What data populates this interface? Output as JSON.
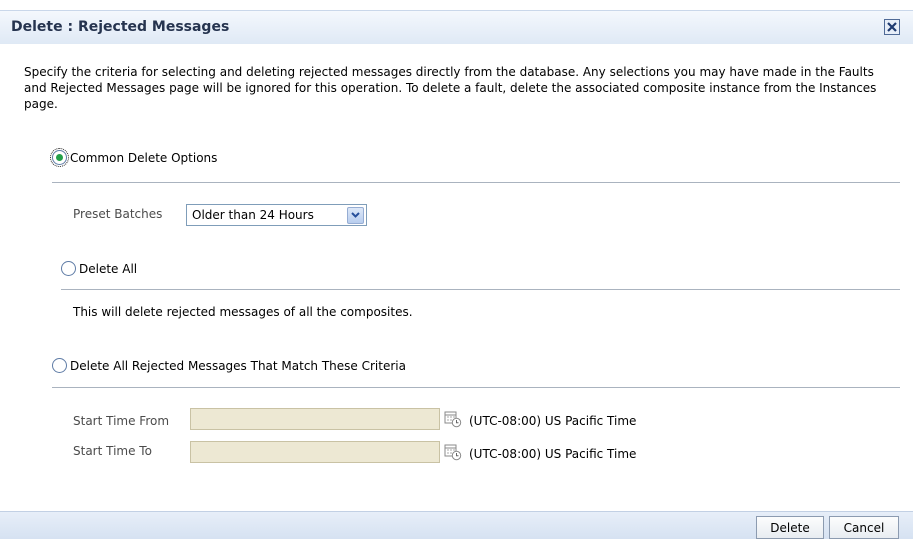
{
  "dialog": {
    "title": "Delete : Rejected Messages",
    "description": "Specify the criteria for selecting and deleting rejected messages directly from the database. Any selections you may have made in the Faults and Rejected Messages page will be ignored for this operation. To delete a fault, delete the associated composite instance from the Instances page."
  },
  "options": {
    "common": {
      "label": "Common Delete Options",
      "selected": true
    },
    "delete_all": {
      "label": "Delete All",
      "selected": false,
      "note": "This will delete rejected messages of all the composites."
    },
    "criteria": {
      "label": "Delete All Rejected Messages That Match These Criteria",
      "selected": false
    }
  },
  "preset": {
    "label": "Preset Batches",
    "value": "Older than 24 Hours"
  },
  "start_from": {
    "label": "Start Time From",
    "value": "",
    "timezone": "(UTC-08:00) US Pacific Time"
  },
  "start_to": {
    "label": "Start Time To",
    "value": "",
    "timezone": "(UTC-08:00) US Pacific Time"
  },
  "buttons": {
    "delete": "Delete",
    "cancel": "Cancel"
  },
  "colors": {
    "accent": "#23a04a",
    "title": "#26344f",
    "input_disabled": "#ede8d3"
  }
}
